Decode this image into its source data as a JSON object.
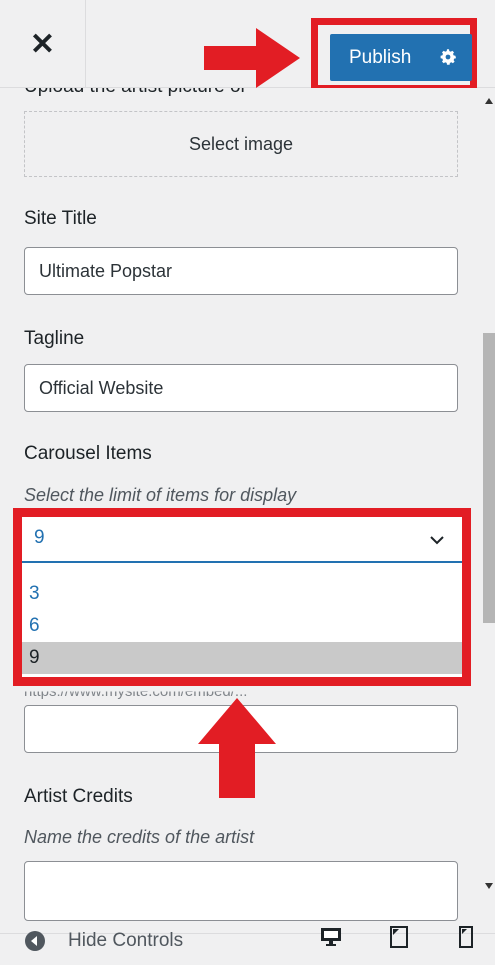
{
  "header": {
    "close_icon": "close-icon",
    "publish_label": "Publish",
    "settings_icon": "gear-icon"
  },
  "fields": {
    "image_section_label": "Upload the artist picture or",
    "select_image_label": "Select image",
    "site_title_label": "Site Title",
    "site_title_value": "Ultimate Popstar",
    "tagline_label": "Tagline",
    "tagline_value": "Official Website",
    "carousel_label": "Carousel Items",
    "carousel_desc": "Select the limit of items for display",
    "carousel_selected": "9",
    "carousel_options": [
      "3",
      "6",
      "9"
    ],
    "hidden_desc": "https://www.mysite.com/embed/...",
    "artist_credits_label": "Artist Credits",
    "artist_credits_desc": "Name the credits of the artist"
  },
  "footer": {
    "hide_controls_label": "Hide Controls"
  },
  "colors": {
    "accent": "#2271b1",
    "highlight": "#e21d24"
  }
}
